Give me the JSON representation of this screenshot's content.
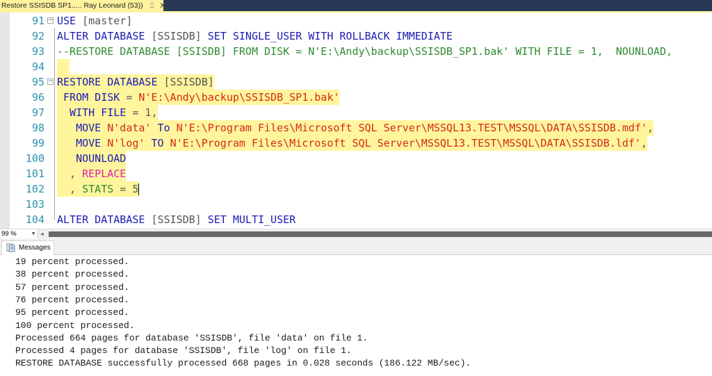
{
  "tab": {
    "title": "Restore SSISDB SP1..... Ray Leonard (53))",
    "pin_icon": "pin-icon",
    "close_icon": "close-icon"
  },
  "editor": {
    "lines": [
      {
        "num": "91",
        "fold": true,
        "tokens": [
          {
            "t": "USE",
            "c": "kw"
          },
          {
            "t": " [master]",
            "c": "gray"
          }
        ]
      },
      {
        "num": "92",
        "tokens": [
          {
            "t": "ALTER DATABASE ",
            "c": "kw"
          },
          {
            "t": "[SSISDB]",
            "c": "gray"
          },
          {
            "t": " SET SINGLE_USER WITH ROLLBACK IMMEDIATE",
            "c": "kw"
          }
        ]
      },
      {
        "num": "93",
        "tokens": [
          {
            "t": "--RESTORE DATABASE [SSISDB] FROM DISK = N'E:\\Andy\\backup\\SSISDB_SP1.bak' WITH FILE = 1,  NOUNLOAD,",
            "c": "cm"
          }
        ]
      },
      {
        "num": "94",
        "tokens": []
      },
      {
        "num": "95",
        "fold": true,
        "tokens": [
          {
            "t": "RESTORE DATABASE ",
            "c": "kw"
          },
          {
            "t": "[SSISDB]",
            "c": "gray"
          }
        ]
      },
      {
        "num": "96",
        "tokens": [
          {
            "t": " FROM DISK ",
            "c": "kw"
          },
          {
            "t": "= ",
            "c": "gray"
          },
          {
            "t": "N'E:\\Andy\\backup\\SSISDB_SP1.bak'",
            "c": "str"
          }
        ]
      },
      {
        "num": "97",
        "tokens": [
          {
            "t": "  WITH FILE ",
            "c": "kw"
          },
          {
            "t": "= 1,",
            "c": "gray"
          }
        ]
      },
      {
        "num": "98",
        "tokens": [
          {
            "t": "   MOVE ",
            "c": "kw"
          },
          {
            "t": "N'data'",
            "c": "str"
          },
          {
            "t": " To ",
            "c": "kw"
          },
          {
            "t": "N'E:\\Program Files\\Microsoft SQL Server\\MSSQL13.TEST\\MSSQL\\DATA\\SSISDB.mdf'",
            "c": "str"
          },
          {
            "t": ",",
            "c": "gray"
          }
        ]
      },
      {
        "num": "99",
        "tokens": [
          {
            "t": "   MOVE ",
            "c": "kw"
          },
          {
            "t": "N'log'",
            "c": "str"
          },
          {
            "t": " TO ",
            "c": "kw"
          },
          {
            "t": "N'E:\\Program Files\\Microsoft SQL Server\\MSSQL13.TEST\\MSSQL\\DATA\\SSISDB.ldf'",
            "c": "str"
          },
          {
            "t": ",",
            "c": "gray"
          }
        ]
      },
      {
        "num": "100",
        "tokens": [
          {
            "t": "   NOUNLOAD",
            "c": "kw"
          }
        ]
      },
      {
        "num": "101",
        "tokens": [
          {
            "t": "  , ",
            "c": "gray"
          },
          {
            "t": "REPLACE",
            "c": "pink"
          }
        ]
      },
      {
        "num": "102",
        "tokens": [
          {
            "t": "  , ",
            "c": "gray"
          },
          {
            "t": "STATS",
            "c": "grn"
          },
          {
            "t": " = 5",
            "c": "gray"
          }
        ],
        "caret": true
      },
      {
        "num": "103",
        "tokens": []
      },
      {
        "num": "104",
        "tokens": [
          {
            "t": "ALTER DATABASE ",
            "c": "kw"
          },
          {
            "t": "[SSISDB]",
            "c": "gray"
          },
          {
            "t": " SET MULTI_USER",
            "c": "kw"
          }
        ]
      }
    ],
    "highlighted_lines": [
      "94",
      "95",
      "96",
      "97",
      "98",
      "99",
      "100",
      "101",
      "102"
    ]
  },
  "status": {
    "zoom_level": "99 %"
  },
  "results": {
    "tab_label": "Messages",
    "messages": [
      "19 percent processed.",
      "38 percent processed.",
      "57 percent processed.",
      "76 percent processed.",
      "95 percent processed.",
      "100 percent processed.",
      "Processed 664 pages for database 'SSISDB', file 'data' on file 1.",
      "Processed 4 pages for database 'SSISDB', file 'log' on file 1.",
      "RESTORE DATABASE successfully processed 668 pages in 0.028 seconds (186.122 MB/sec)."
    ]
  },
  "colors": {
    "tab_active": "#fff29d",
    "tab_bar": "#293955",
    "line_highlight": "#fff59d",
    "keyword": "#1b1bb3",
    "string": "#d42a1a",
    "comment": "#2e8b2e",
    "line_number": "#2b91af"
  }
}
